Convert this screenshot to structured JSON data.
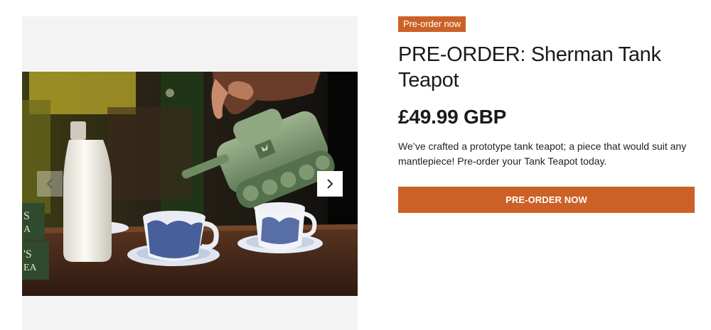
{
  "product": {
    "badge": "Pre-order now",
    "title": "PRE-ORDER: Sherman Tank Teapot",
    "price": "£49.99 GBP",
    "description": "We’ve crafted a prototype tank teapot; a piece that would suit any mantlepiece! Pre-order your Tank Teapot today.",
    "cta_label": "PRE-ORDER NOW"
  },
  "gallery": {
    "image_description": "Green ceramic tank-shaped teapot pouring into blue and white china teacups on a wooden tray, with a milk bottle and tea boxes",
    "prev_icon": "chevron-left-icon",
    "next_icon": "chevron-right-icon"
  },
  "colors": {
    "accent": "#cc6127",
    "gallery_bg": "#f3f3f3",
    "text": "#1a1a1a"
  }
}
